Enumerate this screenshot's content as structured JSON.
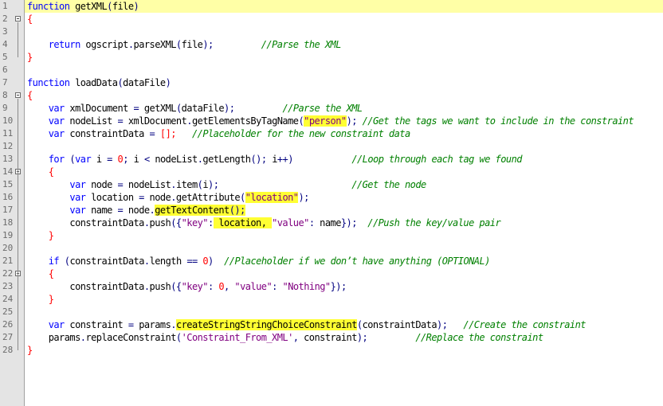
{
  "editor": {
    "lines": [
      {
        "n": "1",
        "fold": "",
        "current": true,
        "tokens": [
          {
            "t": "function",
            "c": "kw"
          },
          {
            "t": " getXML",
            "c": "id"
          },
          {
            "t": "(",
            "c": "op"
          },
          {
            "t": "file",
            "c": "id"
          },
          {
            "t": ")",
            "c": "op"
          }
        ]
      },
      {
        "n": "2",
        "fold": "open",
        "tokens": [
          {
            "t": "{",
            "c": "br"
          }
        ]
      },
      {
        "n": "3",
        "tokens": []
      },
      {
        "n": "4",
        "tokens": [
          {
            "t": "    return",
            "c": "kw"
          },
          {
            "t": " ogscript",
            "c": "id"
          },
          {
            "t": ".",
            "c": "op"
          },
          {
            "t": "parseXML",
            "c": "id"
          },
          {
            "t": "(",
            "c": "op"
          },
          {
            "t": "file",
            "c": "id"
          },
          {
            "t": ");",
            "c": "op"
          },
          {
            "t": "         ",
            "c": "id"
          },
          {
            "t": "//Parse the XML",
            "c": "cm"
          }
        ]
      },
      {
        "n": "5",
        "tokens": [
          {
            "t": "}",
            "c": "br"
          }
        ]
      },
      {
        "n": "6",
        "tokens": []
      },
      {
        "n": "7",
        "tokens": [
          {
            "t": "function",
            "c": "kw"
          },
          {
            "t": " loadData",
            "c": "id"
          },
          {
            "t": "(",
            "c": "op"
          },
          {
            "t": "dataFile",
            "c": "id"
          },
          {
            "t": ")",
            "c": "op"
          }
        ]
      },
      {
        "n": "8",
        "fold": "open",
        "tokens": [
          {
            "t": "{",
            "c": "br"
          }
        ]
      },
      {
        "n": "9",
        "tokens": [
          {
            "t": "    var",
            "c": "kw"
          },
          {
            "t": " xmlDocument ",
            "c": "id"
          },
          {
            "t": "=",
            "c": "op"
          },
          {
            "t": " getXML",
            "c": "id"
          },
          {
            "t": "(",
            "c": "op"
          },
          {
            "t": "dataFile",
            "c": "id"
          },
          {
            "t": ");",
            "c": "op"
          },
          {
            "t": "         ",
            "c": "id"
          },
          {
            "t": "//Parse the XML",
            "c": "cm"
          }
        ]
      },
      {
        "n": "10",
        "tokens": [
          {
            "t": "    var",
            "c": "kw"
          },
          {
            "t": " nodeList ",
            "c": "id"
          },
          {
            "t": "=",
            "c": "op"
          },
          {
            "t": " xmlDocument",
            "c": "id"
          },
          {
            "t": ".",
            "c": "op"
          },
          {
            "t": "getElementsByTagName",
            "c": "id"
          },
          {
            "t": "(",
            "c": "op"
          },
          {
            "t": "\"person\"",
            "c": "str",
            "hl": true
          },
          {
            "t": ");",
            "c": "op"
          },
          {
            "t": " ",
            "c": "id"
          },
          {
            "t": "//Get the tags we want to include in the constraint",
            "c": "cm"
          }
        ]
      },
      {
        "n": "11",
        "tokens": [
          {
            "t": "    var",
            "c": "kw"
          },
          {
            "t": " constraintData ",
            "c": "id"
          },
          {
            "t": "=",
            "c": "op"
          },
          {
            "t": " ",
            "c": "id"
          },
          {
            "t": "[];",
            "c": "br"
          },
          {
            "t": "   ",
            "c": "id"
          },
          {
            "t": "//Placeholder for the new constraint data",
            "c": "cm"
          }
        ]
      },
      {
        "n": "12",
        "tokens": []
      },
      {
        "n": "13",
        "tokens": [
          {
            "t": "    for",
            "c": "kw"
          },
          {
            "t": " ",
            "c": "id"
          },
          {
            "t": "(",
            "c": "op"
          },
          {
            "t": "var",
            "c": "kw"
          },
          {
            "t": " i ",
            "c": "id"
          },
          {
            "t": "=",
            "c": "op"
          },
          {
            "t": " ",
            "c": "id"
          },
          {
            "t": "0",
            "c": "num"
          },
          {
            "t": ";",
            "c": "op"
          },
          {
            "t": " i ",
            "c": "id"
          },
          {
            "t": "<",
            "c": "op"
          },
          {
            "t": " nodeList",
            "c": "id"
          },
          {
            "t": ".",
            "c": "op"
          },
          {
            "t": "getLength",
            "c": "id"
          },
          {
            "t": "();",
            "c": "op"
          },
          {
            "t": " i",
            "c": "id"
          },
          {
            "t": "++)",
            "c": "op"
          },
          {
            "t": "           ",
            "c": "id"
          },
          {
            "t": "//Loop through each tag we found",
            "c": "cm"
          }
        ]
      },
      {
        "n": "14",
        "fold": "open",
        "tokens": [
          {
            "t": "    {",
            "c": "br"
          }
        ]
      },
      {
        "n": "15",
        "tokens": [
          {
            "t": "        var",
            "c": "kw"
          },
          {
            "t": " node ",
            "c": "id"
          },
          {
            "t": "=",
            "c": "op"
          },
          {
            "t": " nodeList",
            "c": "id"
          },
          {
            "t": ".",
            "c": "op"
          },
          {
            "t": "item",
            "c": "id"
          },
          {
            "t": "(",
            "c": "op"
          },
          {
            "t": "i",
            "c": "id"
          },
          {
            "t": ");",
            "c": "op"
          },
          {
            "t": "                         ",
            "c": "id"
          },
          {
            "t": "//Get the node",
            "c": "cm"
          }
        ]
      },
      {
        "n": "16",
        "tokens": [
          {
            "t": "        var",
            "c": "kw"
          },
          {
            "t": " location ",
            "c": "id"
          },
          {
            "t": "=",
            "c": "op"
          },
          {
            "t": " node",
            "c": "id"
          },
          {
            "t": ".",
            "c": "op"
          },
          {
            "t": "getAttribute",
            "c": "id"
          },
          {
            "t": "(",
            "c": "op"
          },
          {
            "t": "\"location\"",
            "c": "str",
            "hl": true
          },
          {
            "t": ");",
            "c": "op"
          }
        ]
      },
      {
        "n": "17",
        "tokens": [
          {
            "t": "        var",
            "c": "kw"
          },
          {
            "t": " name ",
            "c": "id"
          },
          {
            "t": "=",
            "c": "op"
          },
          {
            "t": " node",
            "c": "id"
          },
          {
            "t": ".",
            "c": "op"
          },
          {
            "t": "getTextContent",
            "c": "id",
            "hl": true
          },
          {
            "t": "();",
            "c": "op",
            "hl": true
          }
        ]
      },
      {
        "n": "18",
        "tokens": [
          {
            "t": "        constraintData",
            "c": "id"
          },
          {
            "t": ".",
            "c": "op"
          },
          {
            "t": "push",
            "c": "id"
          },
          {
            "t": "({",
            "c": "op"
          },
          {
            "t": "\"key\"",
            "c": "str"
          },
          {
            "t": ":",
            "c": "op"
          },
          {
            "t": " location, ",
            "c": "id",
            "hl": true
          },
          {
            "t": "\"value\"",
            "c": "str"
          },
          {
            "t": ":",
            "c": "op"
          },
          {
            "t": " name",
            "c": "id"
          },
          {
            "t": "});",
            "c": "op"
          },
          {
            "t": "  ",
            "c": "id"
          },
          {
            "t": "//Push the key/value pair",
            "c": "cm"
          }
        ]
      },
      {
        "n": "19",
        "tokens": [
          {
            "t": "    }",
            "c": "br"
          }
        ]
      },
      {
        "n": "20",
        "tokens": []
      },
      {
        "n": "21",
        "tokens": [
          {
            "t": "    if",
            "c": "kw"
          },
          {
            "t": " ",
            "c": "id"
          },
          {
            "t": "(",
            "c": "op"
          },
          {
            "t": "constraintData",
            "c": "id"
          },
          {
            "t": ".",
            "c": "op"
          },
          {
            "t": "length ",
            "c": "id"
          },
          {
            "t": "==",
            "c": "op"
          },
          {
            "t": " ",
            "c": "id"
          },
          {
            "t": "0",
            "c": "num"
          },
          {
            "t": ")",
            "c": "op"
          },
          {
            "t": "  ",
            "c": "id"
          },
          {
            "t": "//Placeholder if we don’t have anything (OPTIONAL)",
            "c": "cm"
          }
        ]
      },
      {
        "n": "22",
        "fold": "open",
        "tokens": [
          {
            "t": "    {",
            "c": "br"
          }
        ]
      },
      {
        "n": "23",
        "tokens": [
          {
            "t": "        constraintData",
            "c": "id"
          },
          {
            "t": ".",
            "c": "op"
          },
          {
            "t": "push",
            "c": "id"
          },
          {
            "t": "({",
            "c": "op"
          },
          {
            "t": "\"key\"",
            "c": "str"
          },
          {
            "t": ":",
            "c": "op"
          },
          {
            "t": " ",
            "c": "id"
          },
          {
            "t": "0",
            "c": "num"
          },
          {
            "t": ",",
            "c": "op"
          },
          {
            "t": " ",
            "c": "id"
          },
          {
            "t": "\"value\"",
            "c": "str"
          },
          {
            "t": ":",
            "c": "op"
          },
          {
            "t": " ",
            "c": "id"
          },
          {
            "t": "\"Nothing\"",
            "c": "str"
          },
          {
            "t": "});",
            "c": "op"
          }
        ]
      },
      {
        "n": "24",
        "tokens": [
          {
            "t": "    }",
            "c": "br"
          }
        ]
      },
      {
        "n": "25",
        "tokens": []
      },
      {
        "n": "26",
        "tokens": [
          {
            "t": "    var",
            "c": "kw"
          },
          {
            "t": " constraint ",
            "c": "id"
          },
          {
            "t": "=",
            "c": "op"
          },
          {
            "t": " params",
            "c": "id"
          },
          {
            "t": ".",
            "c": "op"
          },
          {
            "t": "createStringStringChoiceConstraint",
            "c": "id",
            "hl": true
          },
          {
            "t": "(",
            "c": "op"
          },
          {
            "t": "constraintData",
            "c": "id"
          },
          {
            "t": ");",
            "c": "op"
          },
          {
            "t": "   ",
            "c": "id"
          },
          {
            "t": "//Create the constraint",
            "c": "cm"
          }
        ]
      },
      {
        "n": "27",
        "tokens": [
          {
            "t": "    params",
            "c": "id"
          },
          {
            "t": ".",
            "c": "op"
          },
          {
            "t": "replaceConstraint",
            "c": "id"
          },
          {
            "t": "(",
            "c": "op"
          },
          {
            "t": "'Constraint_From_XML'",
            "c": "str"
          },
          {
            "t": ",",
            "c": "op"
          },
          {
            "t": " constraint",
            "c": "id"
          },
          {
            "t": ");",
            "c": "op"
          },
          {
            "t": "         ",
            "c": "id"
          },
          {
            "t": "//Replace the constraint",
            "c": "cm"
          }
        ]
      },
      {
        "n": "28",
        "tokens": [
          {
            "t": "}",
            "c": "br"
          }
        ]
      }
    ],
    "colors": {
      "keyword": "#0000ff",
      "identifier": "#000000",
      "operator": "#000080",
      "number": "#ff0000",
      "string": "#800080",
      "comment": "#008000",
      "highlight": "#ffff33",
      "current_line": "#ffffa6",
      "gutter": "#e4e4e4"
    }
  }
}
